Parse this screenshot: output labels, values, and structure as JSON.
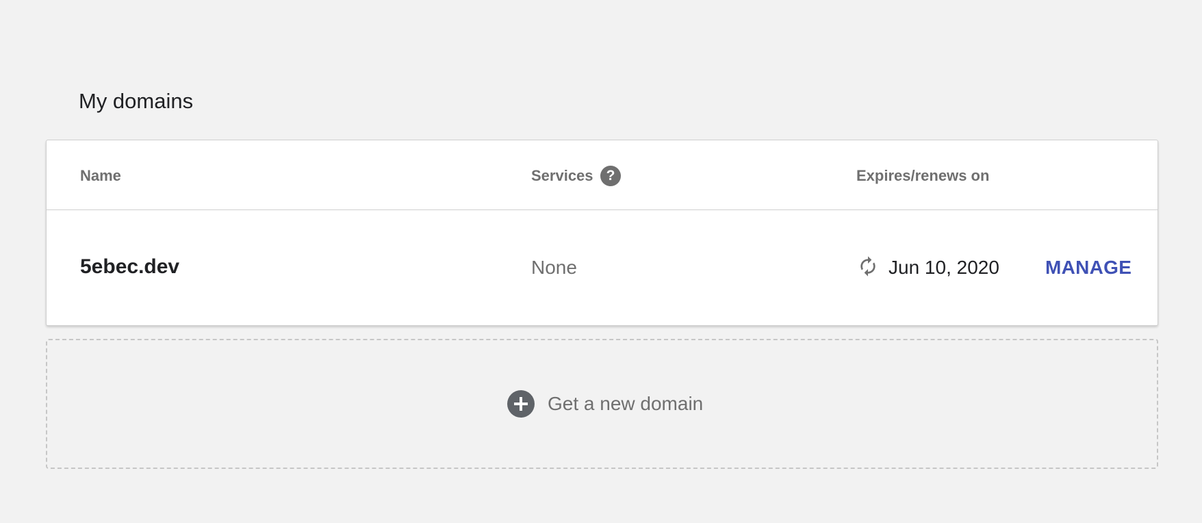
{
  "page": {
    "title": "My domains"
  },
  "table": {
    "headers": {
      "name": "Name",
      "services": "Services",
      "services_help_icon": "question-mark",
      "expires": "Expires/renews on"
    },
    "rows": [
      {
        "name": "5ebec.dev",
        "services": "None",
        "renew_icon": "autorenew",
        "expires": "Jun 10, 2020",
        "action": "MANAGE"
      }
    ]
  },
  "new_domain": {
    "icon": "plus-circle",
    "label": "Get a new domain"
  },
  "colors": {
    "background": "#f2f2f2",
    "accent": "#3f51b5",
    "muted_text": "#6f6f6f",
    "primary_text": "#202124"
  }
}
